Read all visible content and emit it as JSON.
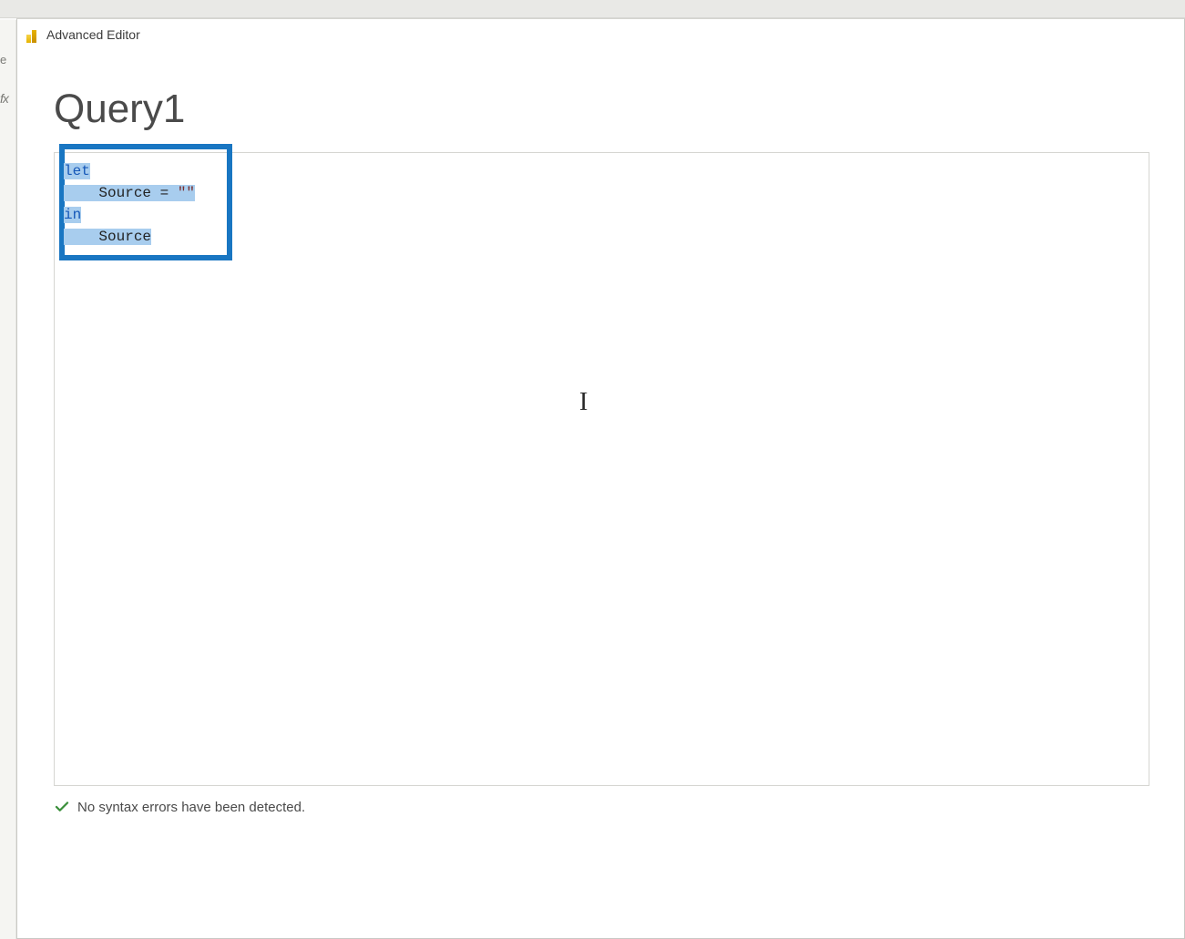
{
  "background": {
    "fx_label": "fx",
    "e_label": "e"
  },
  "dialog": {
    "title": "Advanced Editor"
  },
  "query": {
    "name": "Query1"
  },
  "code": {
    "kw_let": "let",
    "line2_indent": "    ",
    "line2_text": "Source = ",
    "line2_str": "\"\"",
    "kw_in": "in",
    "line4_indent": "    ",
    "line4_text": "Source"
  },
  "status": {
    "message": "No syntax errors have been detected."
  }
}
